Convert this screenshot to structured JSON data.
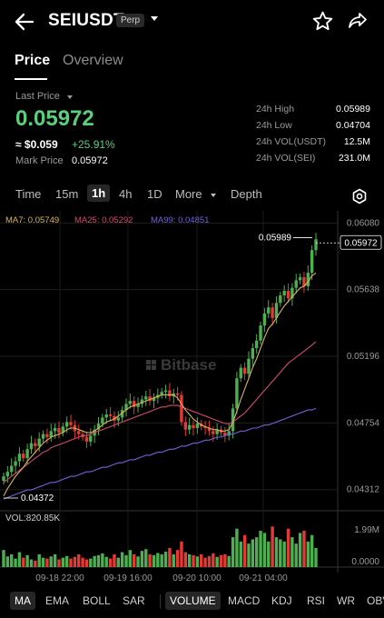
{
  "header": {
    "symbol": "SEIUSDT",
    "badge": "Perp",
    "icons": [
      "back-arrow-icon",
      "chevron-down-icon",
      "star-icon",
      "share-icon"
    ]
  },
  "tabs": [
    {
      "label": "Price",
      "active": true
    },
    {
      "label": "Overview",
      "active": false
    }
  ],
  "price": {
    "last_price_label": "Last Price",
    "last_price": "0.05972",
    "usd_price": "≈ $0.059",
    "change": "+25.91%",
    "mark_label": "Mark Price",
    "mark_value": "0.05972",
    "up_color": "#5bcf7b"
  },
  "stats": [
    {
      "label": "24h High",
      "value": "0.05989"
    },
    {
      "label": "24h Low",
      "value": "0.04704"
    },
    {
      "label": "24h VOL(USDT)",
      "value": "12.5M"
    },
    {
      "label": "24h VOL(SEI)",
      "value": "231.0M"
    }
  ],
  "intervals": [
    {
      "label": "Time",
      "active": false
    },
    {
      "label": "15m",
      "active": false
    },
    {
      "label": "1h",
      "active": true
    },
    {
      "label": "4h",
      "active": false
    },
    {
      "label": "1D",
      "active": false
    },
    {
      "label": "More",
      "active": false
    },
    {
      "label": "Depth",
      "active": false
    }
  ],
  "chart_legend": {
    "ma7": "MA7: 0.05749",
    "ma25": "MA25: 0.05292",
    "ma99": "MA99: 0.04851",
    "ma7_color": "#d8b35a",
    "ma25_color": "#d04a6a",
    "ma99_color": "#6f63d8"
  },
  "chart_data": {
    "type": "candlestick",
    "y_ticks": [
      "0.06080",
      "0.05638",
      "0.05196",
      "0.04754",
      "0.04312"
    ],
    "ylim": [
      0.0422,
      0.061
    ],
    "x_ticks": [
      "09-18 22:00",
      "09-19 16:00",
      "09-20 10:00",
      "09-21 04:00"
    ],
    "high_label": "0.05989",
    "low_label": "0.04372",
    "current_price_label": "0.05972",
    "watermark": "Bitbase",
    "volume_label": "VOL:820.85K",
    "volume_ticks": [
      "1.99M",
      "0.0000"
    ],
    "up_color": "#4caf50",
    "down_color": "#e53935",
    "closes": [
      0.044,
      0.0443,
      0.0447,
      0.045,
      0.0455,
      0.0452,
      0.0458,
      0.0462,
      0.046,
      0.0465,
      0.0468,
      0.0466,
      0.047,
      0.0472,
      0.0469,
      0.0473,
      0.0476,
      0.0474,
      0.047,
      0.0468,
      0.0466,
      0.0463,
      0.0467,
      0.0471,
      0.0475,
      0.0479,
      0.0481,
      0.048,
      0.0477,
      0.0479,
      0.0484,
      0.0488,
      0.049,
      0.0486,
      0.0488,
      0.0491,
      0.0493,
      0.049,
      0.0492,
      0.0494,
      0.0496,
      0.0497,
      0.0493,
      0.0495,
      0.0494,
      0.0476,
      0.0471,
      0.0474,
      0.0472,
      0.0475,
      0.0473,
      0.0472,
      0.047,
      0.0468,
      0.0471,
      0.0469,
      0.0467,
      0.047,
      0.0485,
      0.0505,
      0.0512,
      0.0508,
      0.0518,
      0.0525,
      0.053,
      0.054,
      0.0548,
      0.0552,
      0.0545,
      0.0555,
      0.056,
      0.0563,
      0.0558,
      0.0565,
      0.057,
      0.0572,
      0.0566,
      0.0575,
      0.059,
      0.05972
    ],
    "ma7": [
      0.0427,
      0.0432,
      0.0436,
      0.044,
      0.0443,
      0.0446,
      0.045,
      0.0453,
      0.0456,
      0.0459,
      0.0462,
      0.0464,
      0.0466,
      0.0467,
      0.0468,
      0.0469,
      0.0471,
      0.0472,
      0.0472,
      0.0471,
      0.047,
      0.0469,
      0.0469,
      0.047,
      0.0472,
      0.0474,
      0.0476,
      0.0477,
      0.0478,
      0.048,
      0.0482,
      0.0484,
      0.0486,
      0.0487,
      0.0488,
      0.0489,
      0.049,
      0.0491,
      0.0492,
      0.0493,
      0.0494,
      0.0494,
      0.0494,
      0.0494,
      0.0492,
      0.0488,
      0.0484,
      0.0481,
      0.0478,
      0.0476,
      0.0474,
      0.0473,
      0.0472,
      0.0471,
      0.0471,
      0.047,
      0.047,
      0.0471,
      0.0476,
      0.0483,
      0.0491,
      0.0498,
      0.0505,
      0.0512,
      0.0518,
      0.0525,
      0.0532,
      0.0538,
      0.0541,
      0.0545,
      0.0549,
      0.0553,
      0.0556,
      0.0559,
      0.0562,
      0.0565,
      0.0566,
      0.0569,
      0.0573,
      0.05749
    ],
    "ma25": [
      0.0436,
      0.0438,
      0.044,
      0.0442,
      0.0444,
      0.0446,
      0.0448,
      0.045,
      0.0452,
      0.0454,
      0.0456,
      0.0457,
      0.0459,
      0.046,
      0.0461,
      0.0462,
      0.0463,
      0.0464,
      0.0465,
      0.0466,
      0.0467,
      0.0467,
      0.0468,
      0.0469,
      0.047,
      0.0471,
      0.0472,
      0.0473,
      0.0474,
      0.0475,
      0.0476,
      0.0477,
      0.0478,
      0.0479,
      0.048,
      0.0481,
      0.0482,
      0.0483,
      0.0484,
      0.0485,
      0.0486,
      0.0486,
      0.0487,
      0.0487,
      0.0487,
      0.0486,
      0.0485,
      0.0484,
      0.0483,
      0.0482,
      0.0481,
      0.048,
      0.0479,
      0.0478,
      0.0477,
      0.0476,
      0.0475,
      0.0475,
      0.0476,
      0.0478,
      0.048,
      0.0482,
      0.0485,
      0.0488,
      0.0491,
      0.0494,
      0.0497,
      0.05,
      0.0503,
      0.0506,
      0.0509,
      0.0512,
      0.0515,
      0.0517,
      0.0519,
      0.0521,
      0.0523,
      0.0525,
      0.0527,
      0.05292
    ],
    "ma99": [
      0.0425,
      0.0426,
      0.0427,
      0.0428,
      0.0429,
      0.043,
      0.0431,
      0.0431,
      0.0432,
      0.0433,
      0.0434,
      0.0435,
      0.0436,
      0.0436,
      0.0437,
      0.0438,
      0.0439,
      0.044,
      0.044,
      0.0441,
      0.0442,
      0.0443,
      0.0443,
      0.0444,
      0.0445,
      0.0446,
      0.0446,
      0.0447,
      0.0448,
      0.0449,
      0.0449,
      0.045,
      0.0451,
      0.0451,
      0.0452,
      0.0453,
      0.0454,
      0.0454,
      0.0455,
      0.0456,
      0.0456,
      0.0457,
      0.0458,
      0.0458,
      0.0459,
      0.046,
      0.046,
      0.0461,
      0.0462,
      0.0462,
      0.0463,
      0.0464,
      0.0464,
      0.0465,
      0.0466,
      0.0466,
      0.0467,
      0.0468,
      0.0468,
      0.0469,
      0.047,
      0.047,
      0.0471,
      0.0472,
      0.0472,
      0.0473,
      0.0474,
      0.0474,
      0.0475,
      0.0476,
      0.0477,
      0.0478,
      0.0479,
      0.048,
      0.0481,
      0.0482,
      0.0483,
      0.0484,
      0.0484,
      0.04851
    ],
    "volumes": [
      0.4,
      0.25,
      0.3,
      0.2,
      0.35,
      0.22,
      0.28,
      0.18,
      0.15,
      0.3,
      0.22,
      0.2,
      0.25,
      0.3,
      0.18,
      0.22,
      0.26,
      0.2,
      0.24,
      0.3,
      0.22,
      0.18,
      0.2,
      0.26,
      0.28,
      0.32,
      0.24,
      0.2,
      0.3,
      0.22,
      0.35,
      0.28,
      0.4,
      0.3,
      0.25,
      0.38,
      0.42,
      0.3,
      0.28,
      0.33,
      0.3,
      0.36,
      0.45,
      0.3,
      0.4,
      0.6,
      0.35,
      0.3,
      0.28,
      0.25,
      0.3,
      0.22,
      0.26,
      0.32,
      0.24,
      0.28,
      0.3,
      0.26,
      0.7,
      0.9,
      0.6,
      0.75,
      0.55,
      0.65,
      0.7,
      0.85,
      0.8,
      0.6,
      0.95,
      0.7,
      0.65,
      0.6,
      0.9,
      0.7,
      0.55,
      0.8,
      0.85,
      0.6,
      0.75,
      0.45
    ]
  },
  "indicators": [
    {
      "label": "MA",
      "active": true
    },
    {
      "label": "EMA",
      "active": false
    },
    {
      "label": "BOLL",
      "active": false
    },
    {
      "label": "SAR",
      "active": false
    },
    {
      "label": "VOLUME",
      "active": true
    },
    {
      "label": "MACD",
      "active": false
    },
    {
      "label": "KDJ",
      "active": false
    },
    {
      "label": "RSI",
      "active": false
    },
    {
      "label": "WR",
      "active": false
    },
    {
      "label": "OBV",
      "active": false
    }
  ]
}
